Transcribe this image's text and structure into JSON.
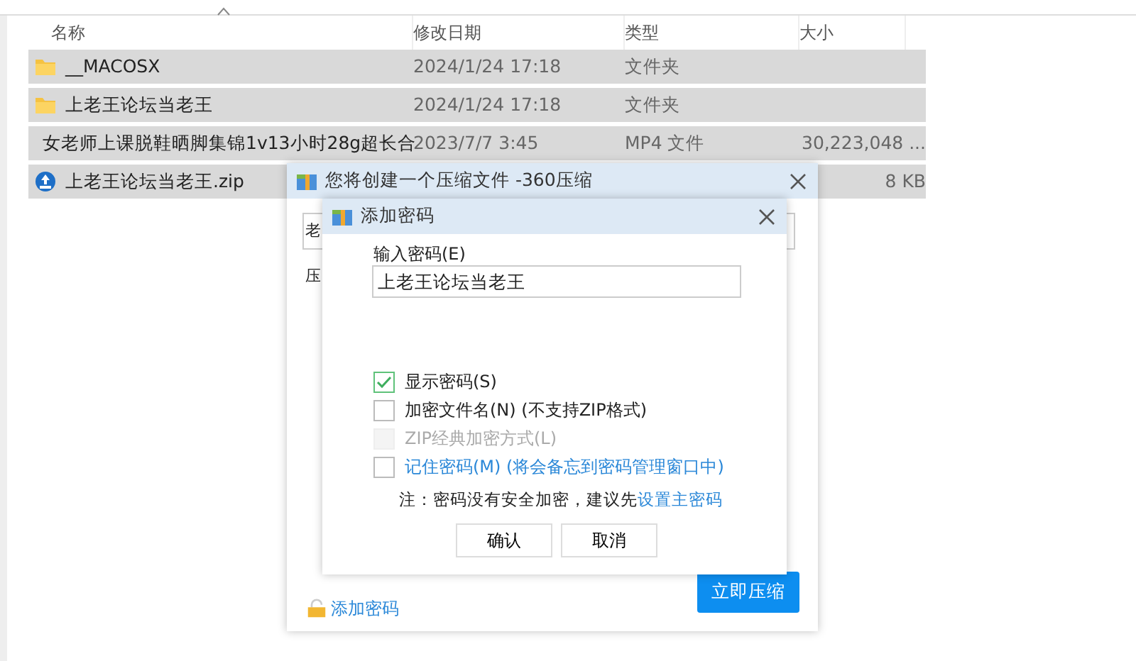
{
  "file_list": {
    "columns": [
      {
        "label": "名称",
        "sorted": true
      },
      {
        "label": "修改日期",
        "sorted": false
      },
      {
        "label": "类型",
        "sorted": false
      },
      {
        "label": "大小",
        "sorted": false
      }
    ],
    "rows": [
      {
        "kind": "folder",
        "selected": true,
        "name": "__MACOSX",
        "date": "2024/1/24 17:18",
        "type": "文件夹",
        "size": ""
      },
      {
        "kind": "folder",
        "selected": true,
        "name": "上老王论坛当老王",
        "date": "2024/1/24 17:18",
        "type": "文件夹",
        "size": ""
      },
      {
        "kind": "video",
        "selected": true,
        "name": "女老师上课脱鞋晒脚集锦1v13小时28g超长合",
        "date": "2023/7/7 3:45",
        "type": "MP4 文件",
        "size": "30,223,048 ..."
      },
      {
        "kind": "zip",
        "selected": true,
        "name": "上老王论坛当老王.zip",
        "date": "",
        "type": "",
        "size": "8 KB"
      }
    ]
  },
  "compress_dialog": {
    "title": "您将创建一个压缩文件 -360压缩",
    "field_value": "老",
    "label": "压",
    "password_link": "添加密码",
    "compress_button": "立即压缩"
  },
  "password_dialog": {
    "title": "添加密码",
    "password_label": "输入密码(E)",
    "password_value": "上老王论坛当老王",
    "options": [
      {
        "label": "显示密码(S)",
        "checked": true,
        "disabled": false,
        "highlight": false
      },
      {
        "label": "加密文件名(N) (不支持ZIP格式)",
        "checked": false,
        "disabled": false,
        "highlight": false
      },
      {
        "label": "ZIP经典加密方式(L)",
        "checked": false,
        "disabled": true,
        "highlight": false
      },
      {
        "label": "记住密码(M) (将会备忘到密码管理窗口中)",
        "checked": false,
        "disabled": false,
        "highlight": true
      }
    ],
    "note": "注：密码没有安全加密，建议先",
    "note_link": "设置主密码",
    "buttons": [
      "确认",
      "取消"
    ]
  }
}
